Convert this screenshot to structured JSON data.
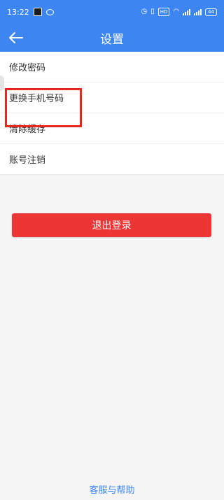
{
  "status_bar": {
    "time": "13:22",
    "hd_label": "HD",
    "battery": "44"
  },
  "header": {
    "title": "设置",
    "back_icon": "arrow-left-icon"
  },
  "settings": {
    "items": [
      {
        "label": "修改密码"
      },
      {
        "label": "更换手机号码"
      },
      {
        "label": "清除缓存"
      },
      {
        "label": "账号注销"
      }
    ]
  },
  "logout_label": "退出登录",
  "help_label": "客服与帮助",
  "colors": {
    "primary": "#3d86f2",
    "danger": "#ee3535",
    "highlight": "#e8281f"
  }
}
